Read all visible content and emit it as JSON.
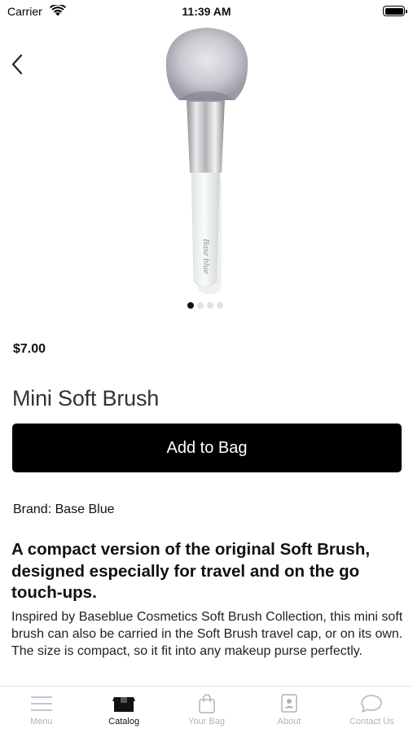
{
  "status_bar": {
    "carrier": "Carrier",
    "time": "11:39 AM"
  },
  "product": {
    "image_icon": "makeup-brush-photo",
    "image_text": "Base blue",
    "carousel": {
      "count": 4,
      "active_index": 0
    },
    "price": "$7.00",
    "title": "Mini Soft Brush",
    "add_to_bag_label": "Add to Bag",
    "brand_line": "Brand: Base Blue",
    "headline": "A compact version of the original Soft Brush, designed especially for travel and on the go touch-ups.",
    "description": "Inspired by Baseblue Cosmetics Soft Brush Collection, this mini soft brush can also be carried in the Soft Brush travel cap, or on its own. The size is compact, so it fit into any makeup purse perfectly."
  },
  "tab_bar": {
    "items": [
      {
        "label": "Menu",
        "icon": "menu-icon",
        "active": false
      },
      {
        "label": "Catalog",
        "icon": "catalog-box-icon",
        "active": true
      },
      {
        "label": "Your Bag",
        "icon": "shopping-bag-icon",
        "active": false
      },
      {
        "label": "About",
        "icon": "contact-card-icon",
        "active": false
      },
      {
        "label": "Contact Us",
        "icon": "chat-bubble-icon",
        "active": false
      }
    ]
  },
  "colors": {
    "accent": "#000000",
    "inactive_tab": "#a8b6c3",
    "active_tab": "#111111"
  }
}
